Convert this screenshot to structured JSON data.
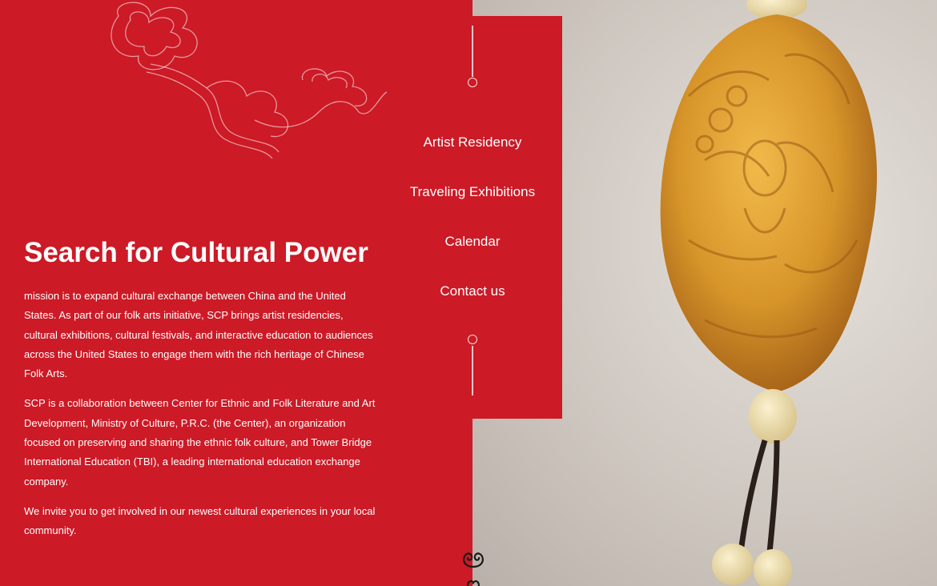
{
  "nav": {
    "items": [
      {
        "label": "Artist Residency"
      },
      {
        "label": "Traveling Exhibitions"
      },
      {
        "label": "Calendar"
      },
      {
        "label": "Contact us"
      }
    ]
  },
  "hero": {
    "title": "Search for Cultural Power",
    "paragraphs": [
      "mission is to expand cultural exchange between China and the United States. As part of our folk arts initiative, SCP brings artist residencies, cultural exhibitions, cultural festivals, and interactive education to audiences across the United States to engage them with the rich heritage of Chinese Folk Arts.",
      "SCP is a collaboration between Center for Ethnic and Folk Literature and Art Development, Ministry of Culture, P.R.C. (the Center), an organization focused on preserving and sharing the ethnic folk culture, and Tower Bridge International Education (TBI), a leading international education exchange company.",
      "We invite you to get involved in our newest cultural experiences in your local community."
    ]
  },
  "colors": {
    "brand_red": "#cc1a26",
    "text": "#ffffff",
    "carving_amber": "#d99a2b"
  },
  "icons": {
    "cloud_ornament": "auspicious-cloud-icon",
    "scroll_down": "swirl-scroll-icon"
  }
}
